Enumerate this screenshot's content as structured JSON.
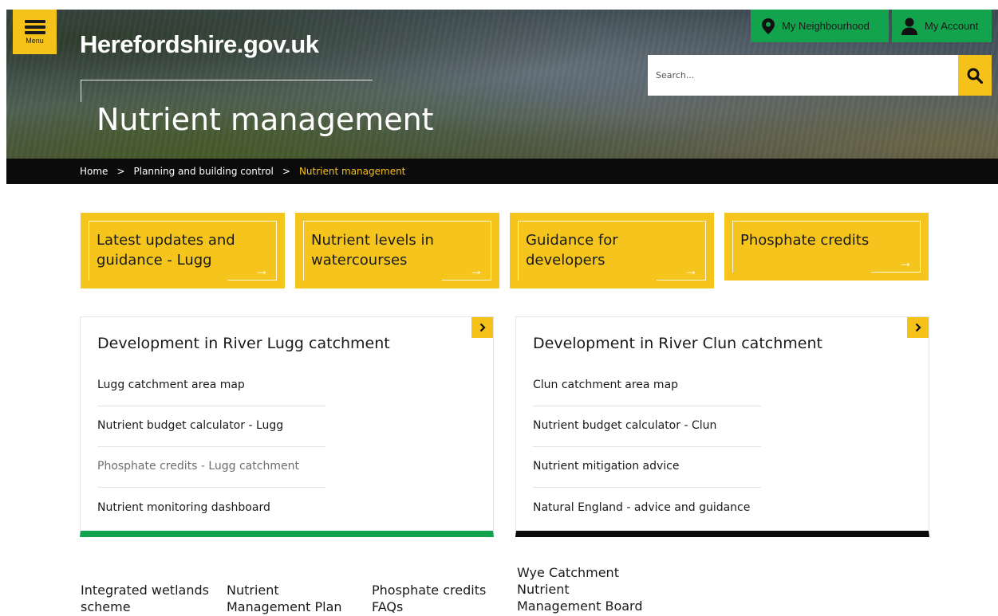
{
  "header": {
    "menu_label": "Menu",
    "logo_text": "Herefordshire.gov.uk",
    "page_title": "Nutrient management",
    "my_neighbourhood": "My Neighbourhood",
    "my_account": "My Account",
    "search_placeholder": "Search..."
  },
  "breadcrumb": {
    "home": "Home",
    "separator": ">",
    "parent": "Planning and building control",
    "current": "Nutrient management"
  },
  "tiles": [
    {
      "line1": "Latest updates and",
      "line2": "guidance - Lugg",
      "arrow": "→"
    },
    {
      "line1": "Nutrient levels in",
      "line2": "watercourses",
      "arrow": "→"
    },
    {
      "line1": "Guidance for",
      "line2": "developers",
      "arrow": "→"
    },
    {
      "line1": "Phosphate credits",
      "line2": "",
      "arrow": "→"
    }
  ],
  "cards": {
    "lugg": {
      "title": "Development in River Lugg catchment",
      "links": [
        "Lugg catchment area map",
        "Nutrient budget calculator - Lugg",
        "Phosphate credits - Lugg catchment",
        "Nutrient monitoring dashboard"
      ]
    },
    "clun": {
      "title": "Development in River Clun catchment",
      "links": [
        "Clun catchment area map",
        "Nutrient budget calculator - Clun",
        "Nutrient mitigation advice",
        "Natural England - advice and guidance"
      ]
    }
  },
  "bottom_links": [
    {
      "line1": "Integrated wetlands",
      "line2": "scheme"
    },
    {
      "line1": "Nutrient",
      "line2": "Management Plan"
    },
    {
      "line1": "Phosphate credits",
      "line2": "FAQs"
    },
    {
      "line1": "Wye Catchment",
      "line2": "Nutrient",
      "line3": "Management Board"
    }
  ],
  "colors": {
    "accent_yellow": "#f5c21a",
    "green": "#12a34c",
    "black": "#0b0b0b"
  },
  "icons": {
    "menu": "hamburger-icon",
    "neighbourhood": "location-pin-icon",
    "account": "person-icon",
    "search": "magnifier-icon",
    "card_more": "chevron-right-icon",
    "tile_go": "arrow-right-icon"
  }
}
